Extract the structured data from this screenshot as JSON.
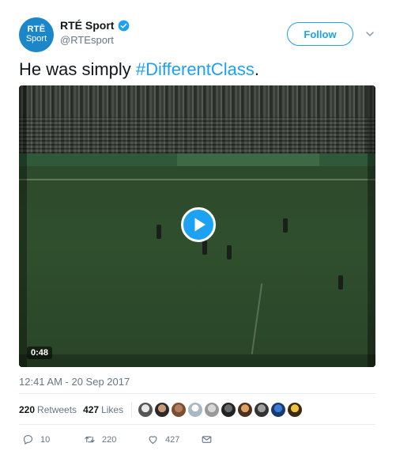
{
  "account": {
    "display_name": "RTÉ Sport",
    "handle": "@RTEsport",
    "avatar_line1": "RTĒ",
    "avatar_line2": "Sport",
    "brand_color": "#1b87c8",
    "verified_icon": "verified-badge-icon"
  },
  "header": {
    "follow_label": "Follow",
    "more_icon": "chevron-down-icon"
  },
  "tweet": {
    "text_prefix": "He was simply ",
    "hashtag": "#DifferentClass",
    "text_suffix": "."
  },
  "video": {
    "duration": "0:48",
    "play_icon": "play-icon"
  },
  "meta": {
    "timestamp": "12:41 AM - 20 Sep 2017"
  },
  "stats": {
    "retweets_count": "220",
    "retweets_label": "Retweets",
    "likes_count": "427",
    "likes_label": "Likes",
    "liker_avatar_count": 10
  },
  "actions": {
    "reply_count": "10",
    "retweet_count": "220",
    "like_count": "427",
    "reply_icon": "reply-icon",
    "retweet_icon": "retweet-icon",
    "like_icon": "heart-icon",
    "dm_icon": "envelope-icon"
  },
  "colors": {
    "accent": "#1da1f2",
    "text": "#14171a",
    "secondary_text": "#657786",
    "divider": "#e6ecf0"
  }
}
